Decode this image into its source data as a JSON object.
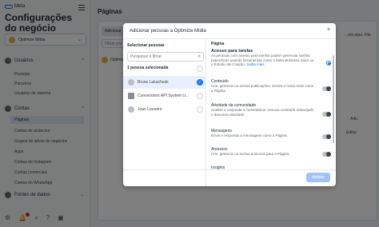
{
  "sidebar": {
    "brand": "Meta",
    "title": "Configurações do negócio",
    "business": "Optimize Mídia",
    "sections": {
      "users": "Usuários",
      "accounts": "Contas",
      "data_sources": "Fontes de dados"
    },
    "user_items": [
      "Pessoas",
      "Parceiros",
      "Usuários do sistema"
    ],
    "account_items": [
      "Páginas",
      "Contas de anúncios",
      "Grupos de ativos de negócios",
      "Apps",
      "Contas do Instagram",
      "Contas comerciais",
      "Contas do WhatsApp"
    ]
  },
  "main": {
    "title": "Páginas",
    "add_label": "Adicionar",
    "filter_placeholder": "Filtrar por",
    "page_name": "Optimize",
    "right_text_1": "...ela aqui. Fila",
    "right_text_2": "...",
    "adjust": "Adic",
    "edit": "Editar"
  },
  "modal": {
    "title": "Adicionar pessoas a Optimize Mídia",
    "close": "×",
    "left": {
      "heading": "Selecionar pessoas",
      "search_placeholder": "Pesquisar e filtrar",
      "selected_count": "1 pessoa selecionada",
      "people": [
        {
          "name": "Bruno Lukachesk",
          "selected": true
        },
        {
          "name": "Conversions API System U...",
          "selected": false
        },
        {
          "name": "Joao Loureiro",
          "selected": false
        }
      ]
    },
    "right": {
      "heading": "Página",
      "perms": [
        {
          "title": "Acesso para tarefas",
          "desc": "As pessoas com acesso para tarefas podem gerenciar tarefas específicas usando ferramentas como o Meta Business Suite ou o Estúdio de Criação.",
          "link": "Saiba mais",
          "on": true
        },
        {
          "title": "Conteúdo",
          "desc": "Crie, gerencie ou exclua publicações, stories e muito mais como a Página.",
          "on": false
        },
        {
          "title": "Atividade da comunidade",
          "desc": "Analise e responda a comentários, remova conteúdo indesejado e denuncie atividade.",
          "on": false
        },
        {
          "title": "Mensagens",
          "desc": "Envie e responda a mensagens como a Página.",
          "on": false
        },
        {
          "title": "Anúncios",
          "desc": "Crie, gerencie ou exclua anúncios para a Página.",
          "on": false
        },
        {
          "title": "Insights",
          "desc": "",
          "on": false
        }
      ]
    },
    "assign_label": "Atribuir"
  },
  "colors": {
    "accent": "#1877f2",
    "overlay": "rgba(0,0,0,0.5)"
  }
}
